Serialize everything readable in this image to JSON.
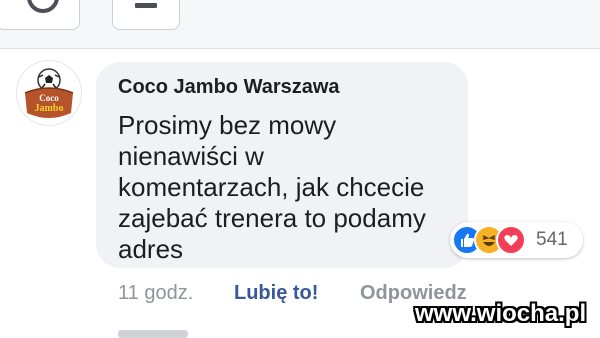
{
  "top_bar": {
    "icons": [
      "circle-icon",
      "minus-icon"
    ]
  },
  "comment": {
    "avatar": {
      "text_line1": "Coco",
      "text_line2": "Jambo",
      "icon": "soccer-ball-icon"
    },
    "author": "Coco Jambo Warszawa",
    "message_lines": [
      "Prosimy bez mowy",
      "nienawiści w",
      "komentarzach, jak chcecie",
      "zajebać trenera to podamy",
      "adres"
    ],
    "reactions": {
      "icons": [
        "like-icon",
        "haha-icon",
        "love-icon"
      ],
      "count": "541"
    },
    "actions": {
      "time": "11 godz.",
      "like": "Lubię to!",
      "reply": "Odpowiedz"
    }
  },
  "watermark": "www.wiocha.pl"
}
